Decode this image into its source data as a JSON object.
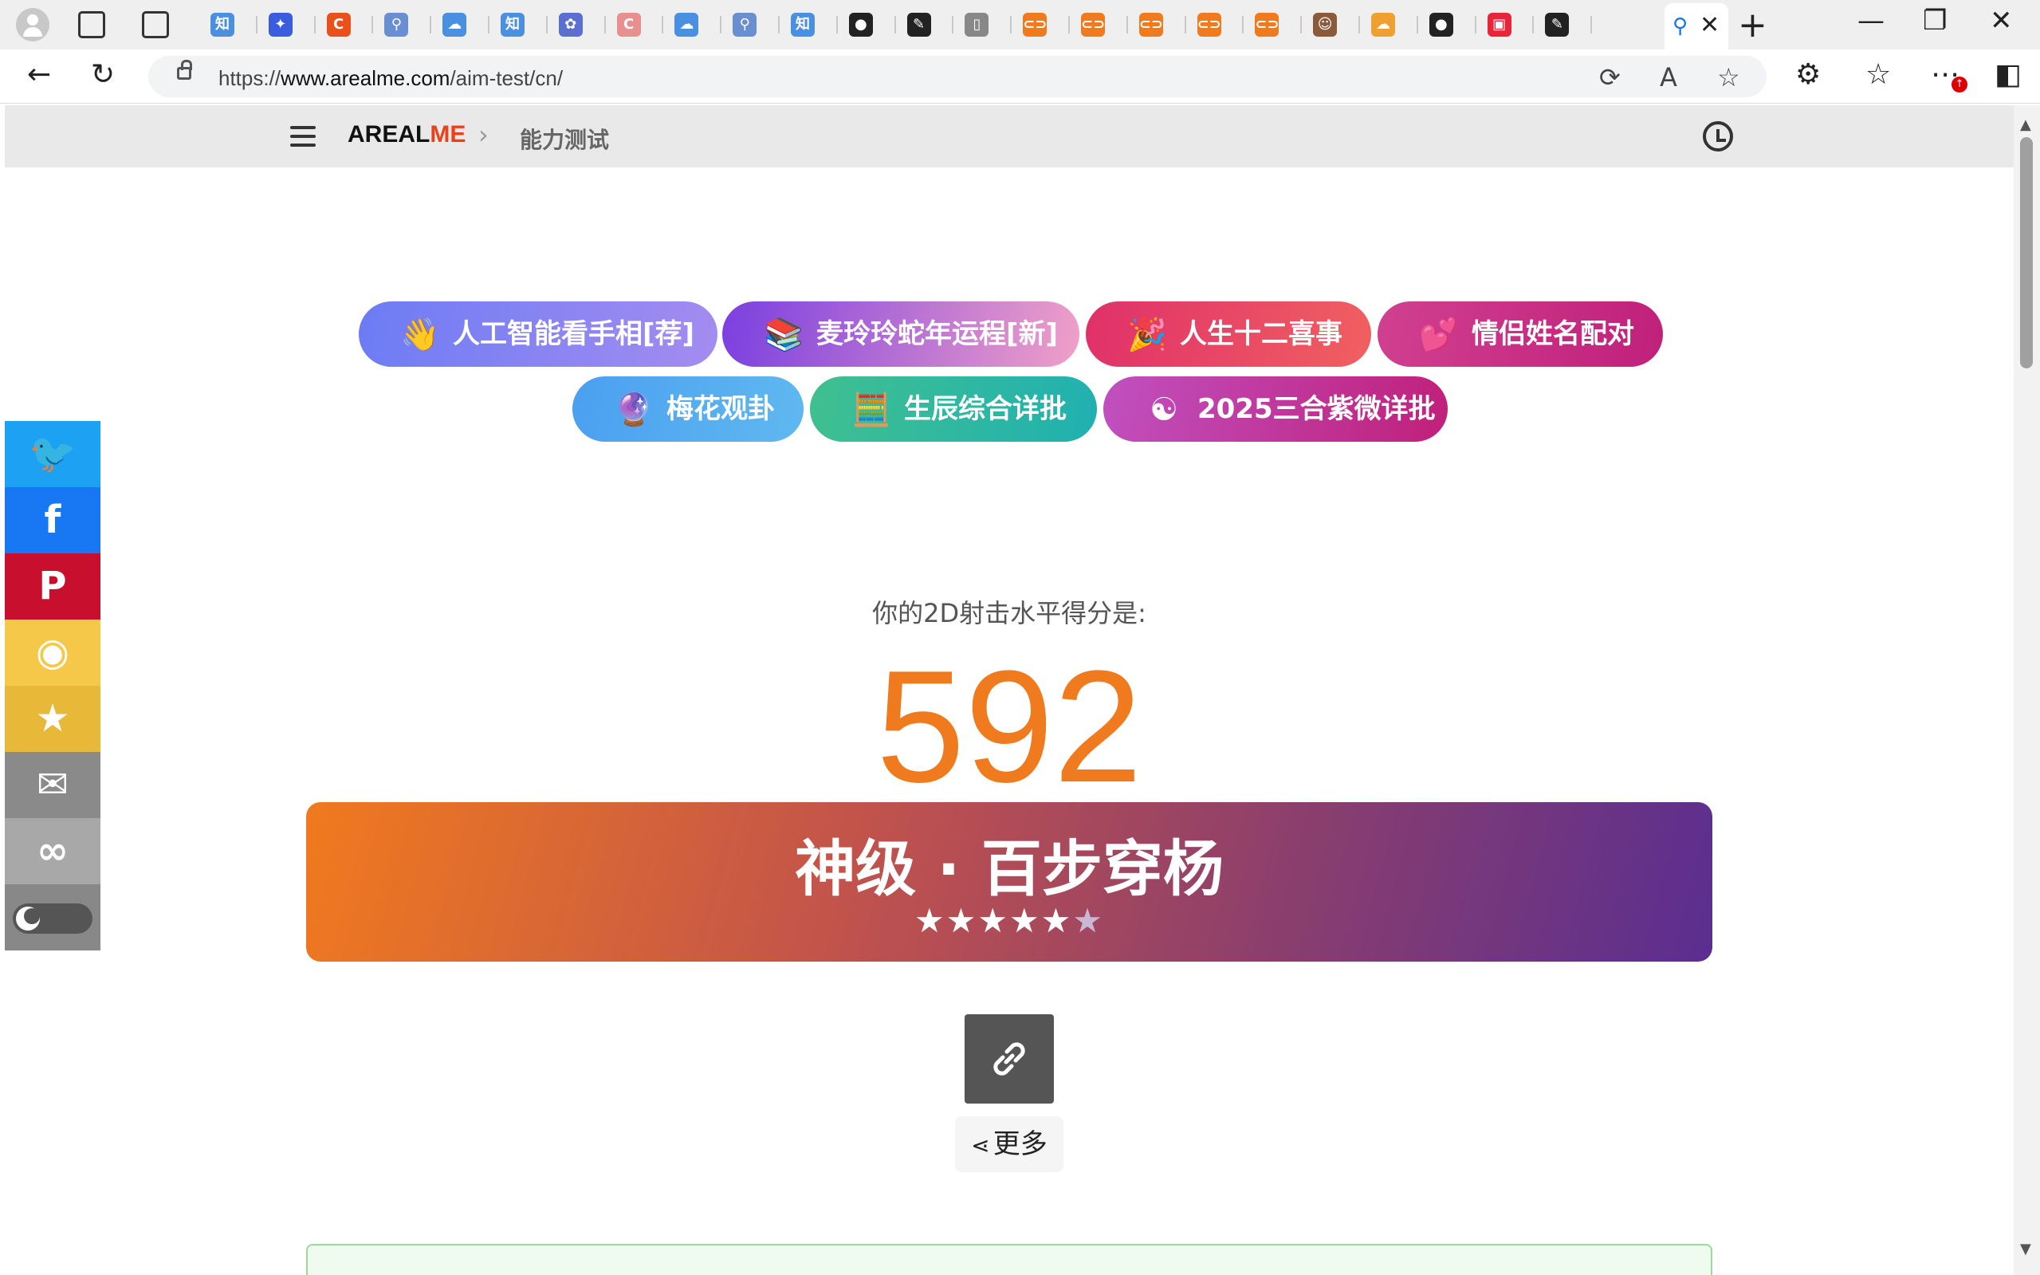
{
  "browser": {
    "url_prefix": "https://",
    "url_host": "www.arealme.com",
    "url_path": "/aim-test/cn/",
    "tabs": [
      {
        "icon": "zhihu-icon",
        "glyph": "知",
        "color": "#4a8fe0"
      },
      {
        "icon": "bird-icon",
        "glyph": "✦",
        "color": "#3a5de0"
      },
      {
        "icon": "c-icon",
        "glyph": "C",
        "color": "#e8521a"
      },
      {
        "icon": "search-icon",
        "glyph": "⚲",
        "color": "#6a8fd0"
      },
      {
        "icon": "cloud-icon",
        "glyph": "☁",
        "color": "#4a90e0"
      },
      {
        "icon": "zhihu-icon",
        "glyph": "知",
        "color": "#4a8fe0"
      },
      {
        "icon": "paw-icon",
        "glyph": "✿",
        "color": "#5a6fd0"
      },
      {
        "icon": "c-icon",
        "glyph": "C",
        "color": "#e89090"
      },
      {
        "icon": "cloud-icon",
        "glyph": "☁",
        "color": "#4a90e0"
      },
      {
        "icon": "search-icon",
        "glyph": "⚲",
        "color": "#6a8fd0"
      },
      {
        "icon": "zhihu-icon",
        "glyph": "知",
        "color": "#4a8fe0"
      },
      {
        "icon": "github-icon",
        "glyph": "●",
        "color": "#222222"
      },
      {
        "icon": "puzzle-icon",
        "glyph": "✎",
        "color": "#222222"
      },
      {
        "icon": "page-icon",
        "glyph": "▯",
        "color": "#888888"
      },
      {
        "icon": "bracket-icon",
        "glyph": "⊂⊃",
        "color": "#f07a1e"
      },
      {
        "icon": "bracket-icon",
        "glyph": "⊂⊃",
        "color": "#f07a1e"
      },
      {
        "icon": "bracket-icon",
        "glyph": "⊂⊃",
        "color": "#f07a1e"
      },
      {
        "icon": "bracket-icon",
        "glyph": "⊂⊃",
        "color": "#f07a1e"
      },
      {
        "icon": "bracket-icon",
        "glyph": "⊂⊃",
        "color": "#f07a1e"
      },
      {
        "icon": "anime-icon",
        "glyph": "☺",
        "color": "#8a5a3a"
      },
      {
        "icon": "cloudflare-icon",
        "glyph": "☁",
        "color": "#f0a030"
      },
      {
        "icon": "github-icon",
        "glyph": "●",
        "color": "#222222"
      },
      {
        "icon": "xiaohongshu-icon",
        "glyph": "▣",
        "color": "#e8243a"
      },
      {
        "icon": "puzzle-icon",
        "glyph": "✎",
        "color": "#222222"
      }
    ]
  },
  "site": {
    "logo_a": "AREAL",
    "logo_b": "ME",
    "breadcrumb": "能力测试"
  },
  "promos": [
    {
      "label": "人工智能看手相[荐]",
      "icon": "waving-hand-icon",
      "glyph": "👋",
      "from": "#6c7cf4",
      "to": "#a48cf0"
    },
    {
      "label": "麦玲玲蛇年运程[新]",
      "icon": "books-icon",
      "glyph": "📚",
      "from": "#7a3fe0",
      "to": "#f0a0c8"
    },
    {
      "label": "人生十二喜事",
      "icon": "party-popper-icon",
      "glyph": "🎉",
      "from": "#e0306a",
      "to": "#f06060"
    },
    {
      "label": "情侣姓名配对",
      "icon": "couple-icon",
      "glyph": "💕",
      "from": "#d04090",
      "to": "#c0207a"
    },
    {
      "label": "梅花观卦",
      "icon": "crystal-ball-icon",
      "glyph": "🔮",
      "from": "#4aa0f0",
      "to": "#60b8f0"
    },
    {
      "label": "生辰综合详批",
      "icon": "abacus-icon",
      "glyph": "🧮",
      "from": "#40c090",
      "to": "#20b0b0"
    },
    {
      "label": "2025三合紫微详批",
      "icon": "yin-yang-icon",
      "glyph": "☯",
      "from": "#c050c0",
      "to": "#c0207a"
    }
  ],
  "result": {
    "label": "你的2D射击水平得分是:",
    "score": "592",
    "rank": "神级 · 百步穿杨",
    "stars_filled": "★★★★★",
    "stars_empty": "★",
    "rating_out_of_6": 5
  },
  "actions": {
    "more_label": "更多"
  },
  "share": [
    {
      "name": "twitter",
      "icon": "twitter-icon",
      "glyph": "🐦",
      "color": "#1da1f2"
    },
    {
      "name": "facebook",
      "icon": "facebook-icon",
      "glyph": "f",
      "color": "#1877f2"
    },
    {
      "name": "pinterest",
      "icon": "pinterest-icon",
      "glyph": "P",
      "color": "#c8102e"
    },
    {
      "name": "weibo",
      "icon": "weibo-icon",
      "glyph": "◉",
      "color": "#f5c84a"
    },
    {
      "name": "qzone",
      "icon": "qzone-icon",
      "glyph": "★",
      "color": "#e8b838"
    },
    {
      "name": "email",
      "icon": "email-icon",
      "glyph": "✉",
      "color": "#8a8a8a"
    },
    {
      "name": "copy-link",
      "icon": "link-icon",
      "glyph": "∞",
      "color": "#a8a8a8"
    }
  ]
}
